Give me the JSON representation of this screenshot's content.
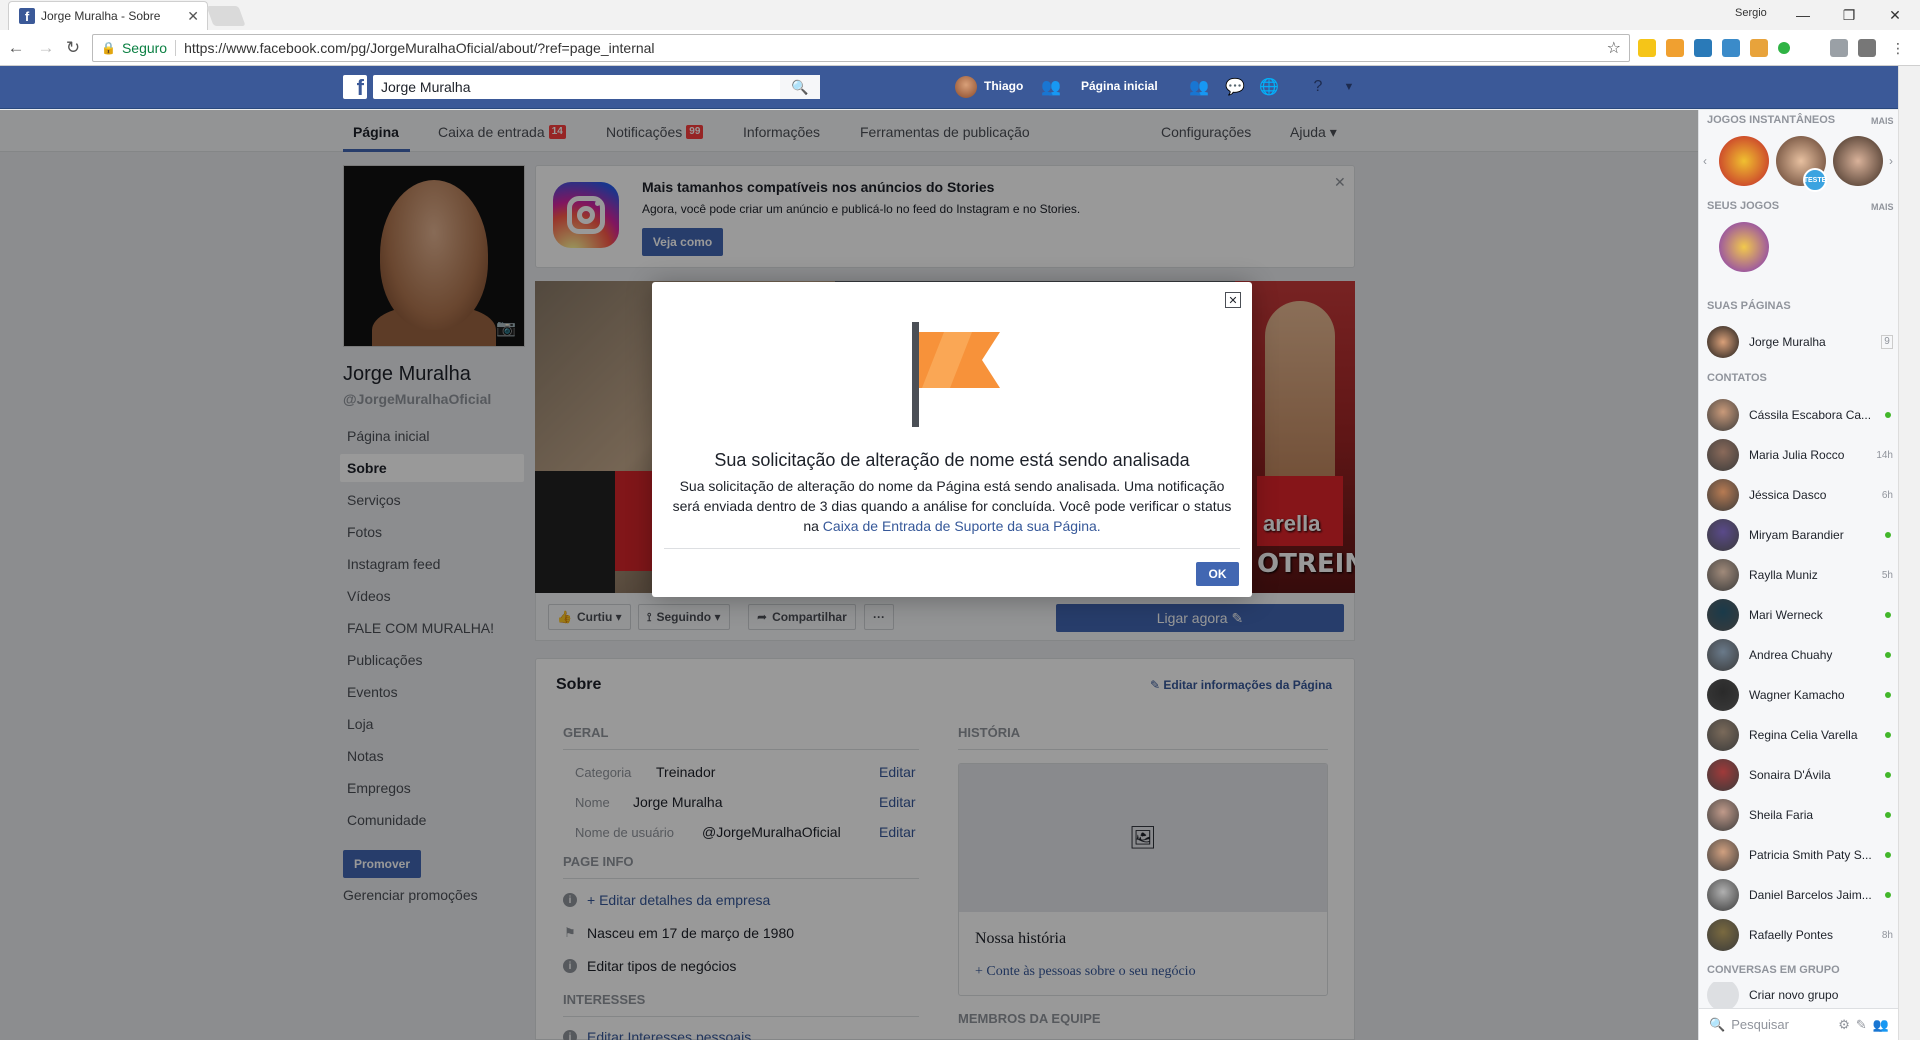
{
  "browser": {
    "tab_title": "Jorge Muralha - Sobre",
    "user_label": "Sergio",
    "secure_label": "Seguro",
    "url": "https://www.facebook.com/pg/JorgeMuralhaOficial/about/?ref=page_internal"
  },
  "fb_header": {
    "search_value": "Jorge Muralha",
    "user_name": "Thiago",
    "home_label": "Página inicial"
  },
  "page_nav": {
    "items": [
      {
        "label": "Página"
      },
      {
        "label": "Caixa de entrada",
        "badge": "14"
      },
      {
        "label": "Notificações",
        "badge": "99"
      },
      {
        "label": "Informações"
      },
      {
        "label": "Ferramentas de publicação"
      },
      {
        "label": "Configurações"
      },
      {
        "label": "Ajuda ▾"
      }
    ]
  },
  "left": {
    "page_name": "Jorge Muralha",
    "page_handle": "@JorgeMuralhaOficial",
    "nav": [
      "Página inicial",
      "Sobre",
      "Serviços",
      "Fotos",
      "Instagram feed",
      "Vídeos",
      "FALE COM MURALHA!",
      "Publicações",
      "Eventos",
      "Loja",
      "Notas",
      "Empregos",
      "Comunidade"
    ],
    "promote_label": "Promover",
    "manage_promos_label": "Gerenciar promoções"
  },
  "notice": {
    "title": "Mais tamanhos compatíveis nos anúncios do Stories",
    "text": "Agora, você pode criar um anúncio e publicá-lo no feed do Instagram e no Stories.",
    "button": "Veja como"
  },
  "cover": {
    "caption_line1": "arella",
    "caption_line2": "OTREINO"
  },
  "actions": {
    "liked": "Curtiu",
    "following": "Seguindo",
    "share": "Compartilhar",
    "more": "···",
    "call_now": "Ligar agora ✎"
  },
  "about": {
    "title": "Sobre",
    "edit_page_info": "✎ Editar informações da Página",
    "general_heading": "GERAL",
    "rows": [
      {
        "label": "Categoria",
        "value": "Treinador",
        "edit": "Editar"
      },
      {
        "label": "Nome",
        "value": "Jorge Muralha",
        "edit": "Editar"
      },
      {
        "label": "Nome de usuário",
        "value": "@JorgeMuralhaOficial",
        "edit": "Editar"
      }
    ],
    "page_info_heading": "PAGE INFO",
    "page_info": [
      "+ Editar detalhes da empresa",
      "Nasceu em 17 de março de 1980",
      "Editar tipos de negócios"
    ],
    "interests_heading": "INTERESSES",
    "interests_item": "Editar Interesses pessoais",
    "history_heading": "HISTÓRIA",
    "story_title": "Nossa história",
    "story_link": "+ Conte às pessoas sobre o seu negócio",
    "team_heading": "MEMBROS DA EQUIPE"
  },
  "sidebar": {
    "instant_games": "JOGOS INSTANTÂNEOS",
    "more": "MAIS",
    "game_badge": "TESTE",
    "your_games": "SEUS JOGOS",
    "your_pages": "SUAS PÁGINAS",
    "page_entry": "Jorge Muralha",
    "page_count": "9",
    "contacts_heading": "CONTATOS",
    "contacts": [
      {
        "name": "Cássila Escabora Ca...",
        "status": ""
      },
      {
        "name": "Maria Julia Rocco",
        "status": "14h"
      },
      {
        "name": "Jéssica Dasco",
        "status": "6h"
      },
      {
        "name": "Miryam Barandier",
        "status": ""
      },
      {
        "name": "Raylla Muniz",
        "status": "5h"
      },
      {
        "name": "Mari Werneck",
        "status": ""
      },
      {
        "name": "Andrea Chuahy",
        "status": ""
      },
      {
        "name": "Wagner Kamacho",
        "status": ""
      },
      {
        "name": "Regina Celia Varella",
        "status": ""
      },
      {
        "name": "Sonaira D'Ávila",
        "status": ""
      },
      {
        "name": "Sheila Faria",
        "status": ""
      },
      {
        "name": "Patricia Smith Paty S...",
        "status": ""
      },
      {
        "name": "Daniel Barcelos Jaim...",
        "status": ""
      },
      {
        "name": "Rafaelly Pontes",
        "status": "8h"
      }
    ],
    "group_chats": "CONVERSAS EM GRUPO",
    "create_group": "Criar novo grupo",
    "search_placeholder": "Pesquisar"
  },
  "modal": {
    "title": "Sua solicitação de alteração de nome está sendo analisada",
    "body": "Sua solicitação de alteração do nome da Página está sendo analisada. Uma notificação será enviada dentro de 3 dias quando a análise for concluída. Você pode verificar o status na",
    "link": "Caixa de Entrada de Suporte da sua Página.",
    "ok": "OK"
  },
  "colors": {
    "fb_blue": "#3b5998",
    "button_blue": "#4267b2",
    "link_blue": "#365899",
    "flag_orange": "#f7923a",
    "online_green": "#42b72a"
  }
}
